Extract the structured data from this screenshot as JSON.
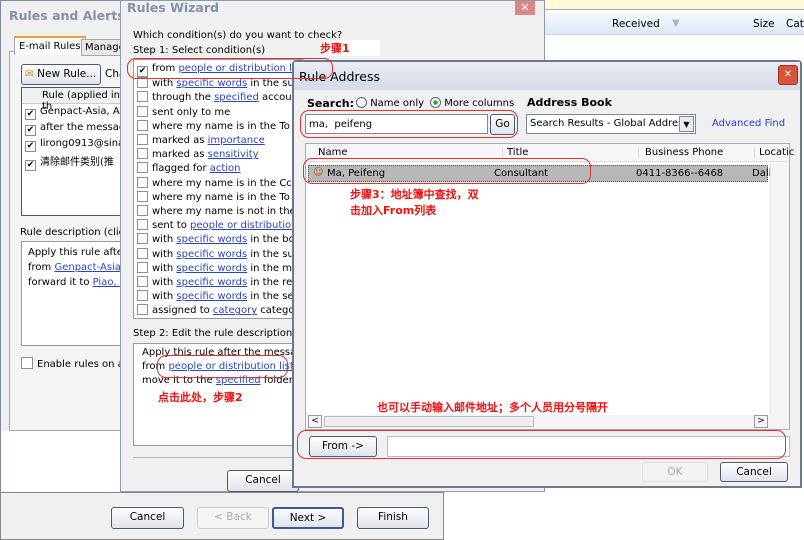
{
  "outlook": {
    "columns": [
      "Received",
      "Size",
      "Cate"
    ]
  },
  "rules_alerts": {
    "title": "Rules and Alerts",
    "tabs": [
      "E-mail Rules",
      "Manage"
    ],
    "new_rule": "New Rule...",
    "change": "Cha",
    "list_header": "Rule (applied in th",
    "rules": [
      "Genpact-Asia, All",
      "after the message",
      "lirong0913@sina.",
      "清除邮件类别(推"
    ],
    "desc_label": "Rule description (click a",
    "desc_lines": [
      {
        "pre": "Apply this rule after",
        "link": ""
      },
      {
        "pre": "from ",
        "link": "Genpact-Asia, A"
      },
      {
        "pre": "forward it to ",
        "link": "Piao, As"
      }
    ],
    "enable_label": "Enable rules on all"
  },
  "wizard": {
    "title": "Rules Wizard",
    "question": "Which condition(s) do you want to check?",
    "step1": "Step 1: Select condition(s)",
    "conditions": [
      {
        "pre": "from ",
        "link": "people or distribution list",
        "post": "",
        "checked": true
      },
      {
        "pre": "with ",
        "link": "specific words",
        "post": " in the subje",
        "checked": false
      },
      {
        "pre": "through the ",
        "link": "specified",
        "post": " account",
        "checked": false
      },
      {
        "pre": "sent only to me",
        "link": "",
        "post": "",
        "checked": false
      },
      {
        "pre": "where my name is in the To bo",
        "link": "",
        "post": "",
        "checked": false
      },
      {
        "pre": "marked as ",
        "link": "importance",
        "post": "",
        "checked": false
      },
      {
        "pre": "marked as ",
        "link": "sensitivity",
        "post": "",
        "checked": false
      },
      {
        "pre": "flagged for ",
        "link": "action",
        "post": "",
        "checked": false
      },
      {
        "pre": "where my name is in the Cc bo",
        "link": "",
        "post": "",
        "checked": false
      },
      {
        "pre": "where my name is in the To or",
        "link": "",
        "post": "",
        "checked": false
      },
      {
        "pre": "where my name is not in the To",
        "link": "",
        "post": "",
        "checked": false
      },
      {
        "pre": "sent to ",
        "link": "people or distribution lis",
        "post": "",
        "checked": false
      },
      {
        "pre": "with ",
        "link": "specific words",
        "post": " in the body",
        "checked": false
      },
      {
        "pre": "with ",
        "link": "specific words",
        "post": " in the subje",
        "checked": false
      },
      {
        "pre": "with ",
        "link": "specific words",
        "post": " in the mess",
        "checked": false
      },
      {
        "pre": "with ",
        "link": "specific words",
        "post": " in the recip",
        "checked": false
      },
      {
        "pre": "with ",
        "link": "specific words",
        "post": " in the send",
        "checked": false
      },
      {
        "pre": "assigned to ",
        "link": "category",
        "post": " category",
        "checked": false
      }
    ],
    "step2": "Step 2: Edit the rule description (cli",
    "desc": [
      {
        "pre": "Apply this rule after the message",
        "link": "",
        "post": ""
      },
      {
        "pre": "from ",
        "link": "people or distribution list",
        "post": ""
      },
      {
        "pre": "move it to the ",
        "link": "specified",
        "post": " folder"
      }
    ],
    "cancel": "Cancel",
    "buttons": {
      "cancel": "Cancel",
      "back": "< Back",
      "next": "Next >",
      "finish": "Finish"
    }
  },
  "address": {
    "title": "Rule Address",
    "search_label": "Search:",
    "radio_name": "Name only",
    "radio_more": "More columns",
    "radio_selected": "More columns",
    "book_label": "Address Book",
    "search_value": "ma,  peifeng",
    "go": "Go",
    "book_value": "Search Results - Global Address",
    "advanced": "Advanced Find",
    "columns": [
      "Name",
      "Title",
      "Business Phone",
      "Locatic"
    ],
    "rows": [
      {
        "name": "Ma, Peifeng",
        "title": "Consultant",
        "phone": "0411-8366--6468",
        "location": "Dalia"
      }
    ],
    "from_btn": "From ->",
    "from_value": "",
    "ok": "OK",
    "cancel": "Cancel"
  },
  "annotations": {
    "step1": "步骤1",
    "step2": "点击此处，步骤2",
    "step3a": "步骤3：地址簿中查找，双",
    "step3b": "击加入From列表",
    "manual": "也可以手动输入邮件地址；多个人员用分号隔开",
    "color": "#e11111"
  }
}
